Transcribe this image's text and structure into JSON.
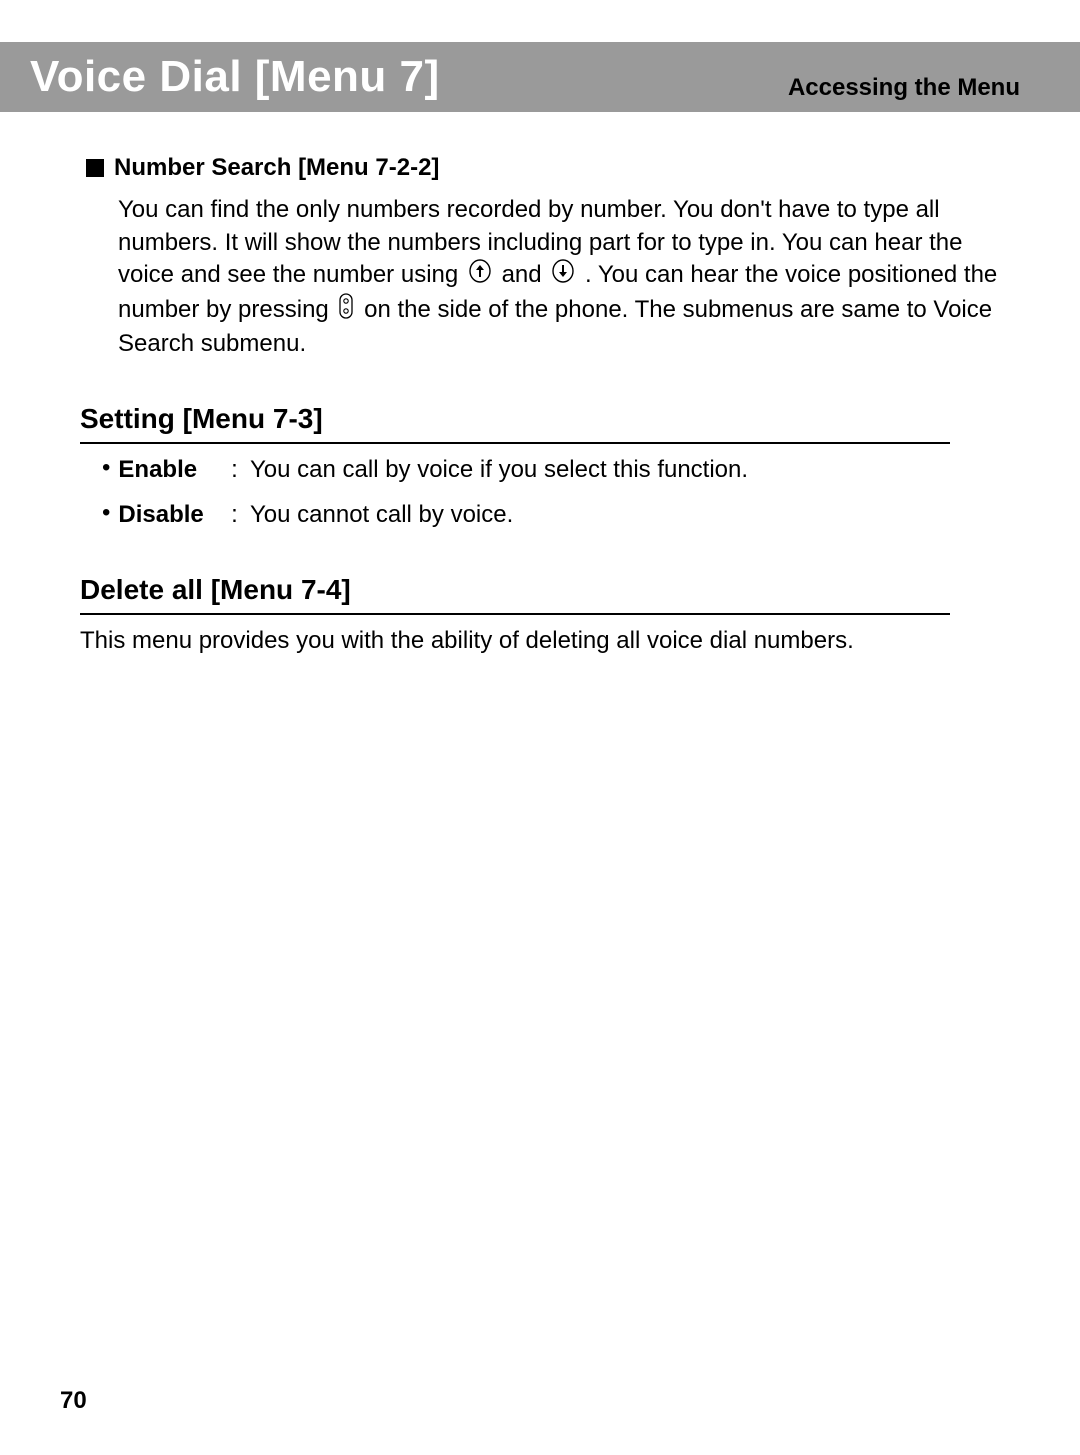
{
  "header": {
    "title": "Voice Dial [Menu 7]",
    "breadcrumb": "Accessing the Menu"
  },
  "number_search": {
    "heading": "Number Search [Menu 7-2-2]",
    "para_a": "You can find the only numbers recorded by number. You don't have to type all numbers. It will show the numbers including part for to type in. You can hear the voice and see the number using ",
    "and": " and ",
    "para_b": ". You can hear the voice positioned the number by pressing ",
    "para_c": " on the side of the phone. The submenus are same to Voice Search submenu."
  },
  "setting": {
    "heading": "Setting [Menu 7-3]",
    "options": [
      {
        "label": "Enable",
        "desc": "You can call by voice if you select this function."
      },
      {
        "label": "Disable",
        "desc": "You cannot call by voice."
      }
    ]
  },
  "delete_all": {
    "heading": "Delete all [Menu 7-4]",
    "body": "This menu provides you with the ability of deleting all voice dial numbers."
  },
  "page_number": "70"
}
